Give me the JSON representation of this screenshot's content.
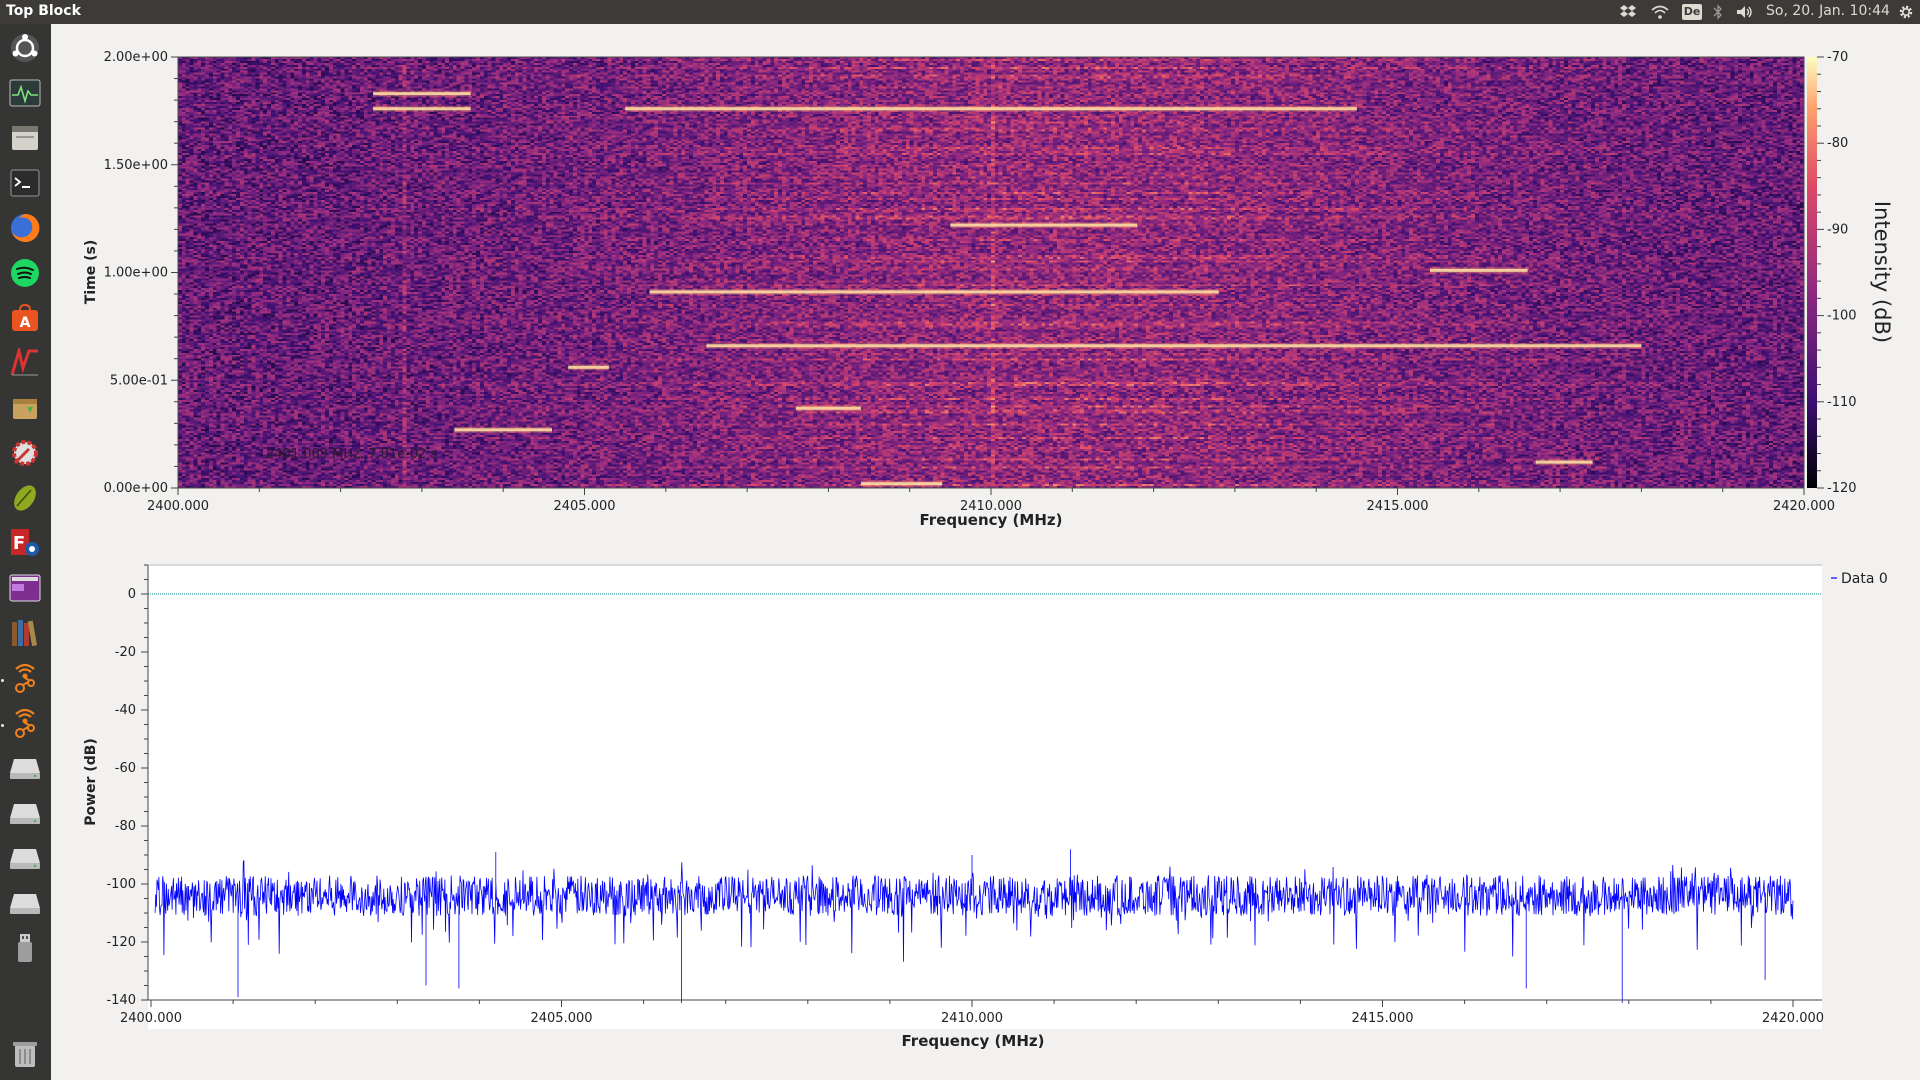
{
  "topbar": {
    "window_title": "Top Block",
    "keyboard_layout": "De",
    "clock": "So, 20. Jan. 10:44",
    "indicators": [
      "dropbox-icon",
      "wifi-icon",
      "keyboard-layout-indicator",
      "bluetooth-icon",
      "volume-icon",
      "gear-icon"
    ]
  },
  "launcher": {
    "items": [
      "ubuntu-search-icon",
      "system-monitor-icon",
      "files-icon",
      "terminal-icon",
      "firefox-icon",
      "spotify-icon",
      "software-center-icon",
      "ltspice-icon",
      "archive-manager-icon",
      "gnuradio-companion-icon",
      "inkscape-icon",
      "fritzing-icon",
      "workspace-switcher-icon",
      "library-icon",
      "wifi-network-icon",
      "wifi-network-icon-2",
      "drive-icon-1",
      "drive-icon-2",
      "drive-icon-3",
      "drive-icon-4",
      "usb-drive-icon",
      "trash-icon"
    ],
    "active_indicators": [
      "wifi-network-icon",
      "wifi-network-icon-2"
    ]
  },
  "waterfall": {
    "overlay_readout": "2401.009 MHz, 7.91e-02 s",
    "colors": {
      "low": "#000000",
      "mid": "#8b1f8c",
      "high_mid": "#f45a2a",
      "high": "#fcff9e",
      "background": "#6a1d7e"
    }
  },
  "chart_data": [
    {
      "type": "heatmap",
      "xlabel": "Frequency (MHz)",
      "ylabel": "Time (s)",
      "colorbar_label": "Intensity (dB)",
      "xlim": [
        2400,
        2420
      ],
      "ylim": [
        0,
        2
      ],
      "zlim": [
        -120,
        -70
      ],
      "x_ticks": [
        "2400.000",
        "2405.000",
        "2410.000",
        "2415.000",
        "2420.000"
      ],
      "y_ticks": [
        "0.00e+00",
        "5.00e-01",
        "1.00e+00",
        "1.50e+00",
        "2.00e+00"
      ],
      "colorbar_ticks": [
        "-70",
        "-80",
        "-90",
        "-100",
        "-110",
        "-120"
      ],
      "colormap": [
        "#000004",
        "#3b0f70",
        "#8c2981",
        "#de4968",
        "#fe9f6d",
        "#fcfdbf"
      ],
      "bright_bursts": [
        {
          "f_start": 2402.4,
          "f_end": 2403.6,
          "t": 1.76
        },
        {
          "f_start": 2402.4,
          "f_end": 2403.6,
          "t": 1.83
        },
        {
          "f_start": 2405.5,
          "f_end": 2414.5,
          "t": 1.76
        },
        {
          "f_start": 2406.5,
          "f_end": 2418.0,
          "t": 0.66
        },
        {
          "f_start": 2403.4,
          "f_end": 2404.6,
          "t": 0.27
        },
        {
          "f_start": 2409.5,
          "f_end": 2411.8,
          "t": 1.22
        },
        {
          "f_start": 2415.4,
          "f_end": 2416.6,
          "t": 1.01
        },
        {
          "f_start": 2407.6,
          "f_end": 2408.4,
          "t": 0.37
        },
        {
          "f_start": 2404.8,
          "f_end": 2405.3,
          "t": 0.56
        },
        {
          "f_start": 2416.7,
          "f_end": 2417.4,
          "t": 0.12
        },
        {
          "f_start": 2408.4,
          "f_end": 2409.4,
          "t": 0.02
        },
        {
          "f_start": 2405.8,
          "f_end": 2412.8,
          "t": 0.91
        }
      ]
    },
    {
      "type": "line",
      "xlabel": "Frequency (MHz)",
      "ylabel": "Power (dB)",
      "xlim": [
        2400,
        2420
      ],
      "ylim": [
        -140,
        10
      ],
      "x_ticks": [
        "2400.000",
        "2405.000",
        "2410.000",
        "2415.000",
        "2420.000"
      ],
      "y_ticks": [
        "0",
        "-20",
        "-40",
        "-60",
        "-80",
        "-100",
        "-120",
        "-140"
      ],
      "legend_position": "top-right",
      "series": [
        {
          "name": "Data 0",
          "color": "#0000ff",
          "noise_floor_mean": -104,
          "noise_spread": 7,
          "x_range": [
            2400.05,
            2420.0
          ],
          "deep_dips": [
            {
              "x": 2401.06,
              "y": -139
            },
            {
              "x": 2403.35,
              "y": -135
            },
            {
              "x": 2403.75,
              "y": -136
            },
            {
              "x": 2406.46,
              "y": -141
            },
            {
              "x": 2416.75,
              "y": -136
            },
            {
              "x": 2417.92,
              "y": -141
            },
            {
              "x": 2419.66,
              "y": -133
            }
          ],
          "peaks": [
            {
              "x": 2404.2,
              "y": -89
            },
            {
              "x": 2410.0,
              "y": -90
            },
            {
              "x": 2411.2,
              "y": -88
            }
          ]
        },
        {
          "name": "",
          "color": "#008b8b",
          "constant_value": 0,
          "style": "dotted"
        }
      ]
    }
  ]
}
